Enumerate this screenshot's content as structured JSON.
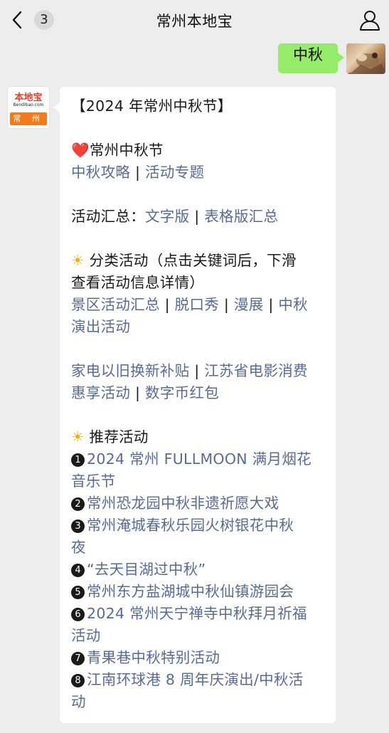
{
  "header": {
    "unread_count": "3",
    "title": "常州本地宝"
  },
  "outgoing": {
    "text": "中秋"
  },
  "bot_avatar": {
    "brand": "本地宝",
    "domain": "Bendibao.com",
    "city": "常 州"
  },
  "message": {
    "heading": "【2024 年常州中秋节】",
    "sec1_icon": "❤️",
    "sec1_title": "常州中秋节",
    "sec1_links": [
      "中秋攻略",
      "活动专题"
    ],
    "summary_label": "活动汇总：",
    "summary_links": [
      "文字版",
      "表格版汇总"
    ],
    "sec2_icon": "☀",
    "sec2_title_line1": "分类活动（点击关键词后，下滑",
    "sec2_title_line2": "查看活动信息详情）",
    "category_links": [
      "景区活动汇总",
      "脱口秀",
      "漫展",
      "中秋",
      "演出活动"
    ],
    "extra_links": [
      "家电以旧换新补贴",
      "江苏省电影消费",
      "惠享活动",
      "数字币红包"
    ],
    "sec3_icon": "☀",
    "sec3_title": "推荐活动",
    "separator": " | ",
    "recommended": [
      {
        "num": "1",
        "line1": "2024 常州 FULLMOON 满月烟花",
        "line2": "音乐节"
      },
      {
        "num": "2",
        "line1": "常州恐龙园中秋非遗祈愿大戏",
        "line2": ""
      },
      {
        "num": "3",
        "line1": "常州淹城春秋乐园火树银花中秋",
        "line2": "夜"
      },
      {
        "num": "4",
        "line1": "“去天目湖过中秋”",
        "line2": ""
      },
      {
        "num": "5",
        "line1": "常州东方盐湖城中秋仙镇游园会",
        "line2": ""
      },
      {
        "num": "6",
        "line1": "2024 常州天宁禅寺中秋拜月祈福",
        "line2": "活动"
      },
      {
        "num": "7",
        "line1": "青果巷中秋特别活动",
        "line2": ""
      },
      {
        "num": "8",
        "line1": "江南环球港 8 周年庆演出/中秋活",
        "line2": "动"
      }
    ]
  }
}
